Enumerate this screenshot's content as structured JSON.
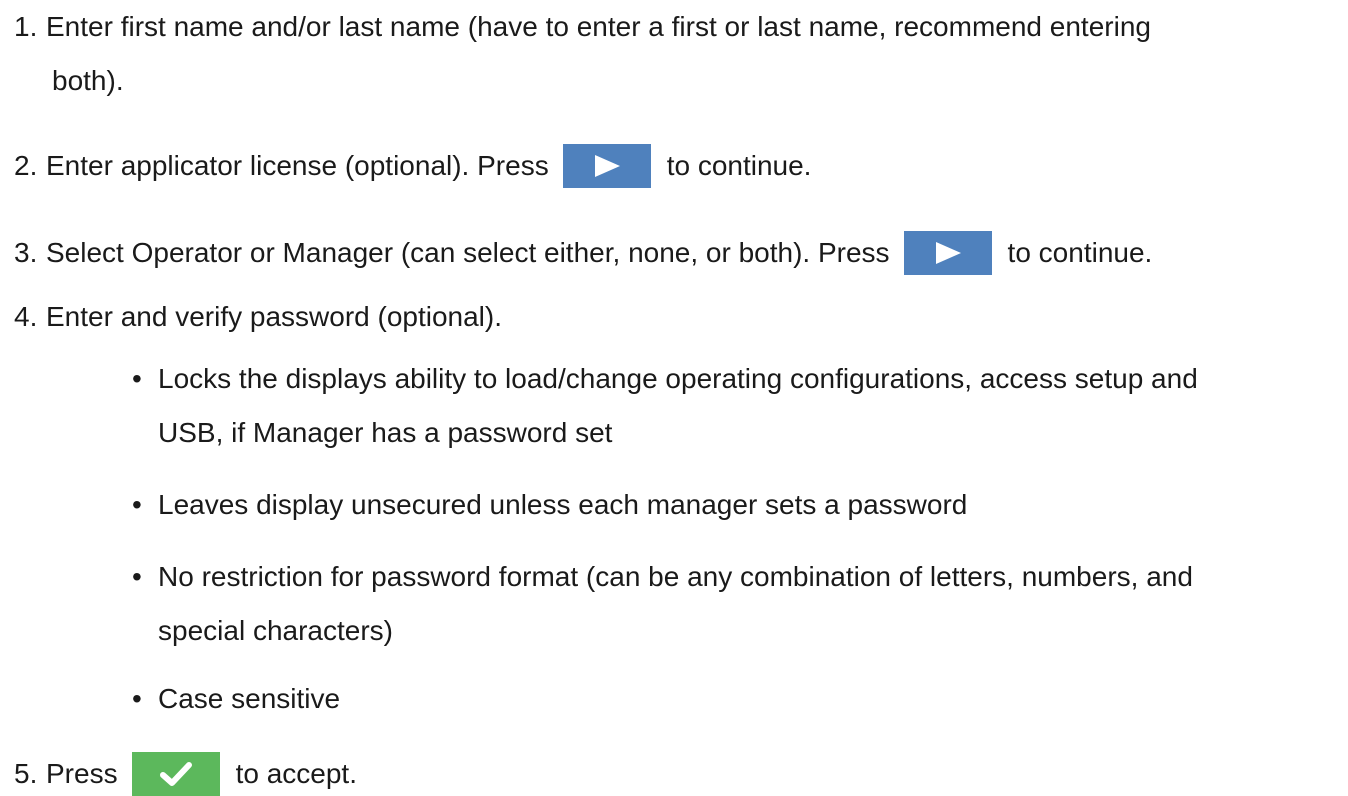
{
  "steps": [
    {
      "number": "1.",
      "line1": "Enter first name and/or last name (have to enter a first or last name, recommend entering",
      "line2": "both)."
    },
    {
      "number": "2.",
      "before": "Enter applicator license (optional). Press",
      "after": "to continue.",
      "button_icon": "play-arrow-icon",
      "button_color": "#4f81bd"
    },
    {
      "number": "3.",
      "before": "Select Operator or Manager (can select either, none, or both). Press",
      "after": "to continue.",
      "button_icon": "play-arrow-icon",
      "button_color": "#4f81bd"
    },
    {
      "number": "4.",
      "text": "Enter and verify password (optional).",
      "bullets": [
        {
          "line1": "Locks the displays ability to load/change operating configurations, access setup and",
          "line2": "USB, if Manager has a password set"
        },
        {
          "line1": "Leaves display unsecured unless each manager sets a password"
        },
        {
          "line1": "No restriction for password format (can be any combination of letters, numbers, and",
          "line2": "special characters)"
        },
        {
          "line1": "Case sensitive"
        }
      ]
    },
    {
      "number": "5.",
      "before": "Press",
      "after": "to accept.",
      "button_icon": "checkmark-icon",
      "button_color": "#5cb85c"
    }
  ],
  "bullet_glyph": "•"
}
